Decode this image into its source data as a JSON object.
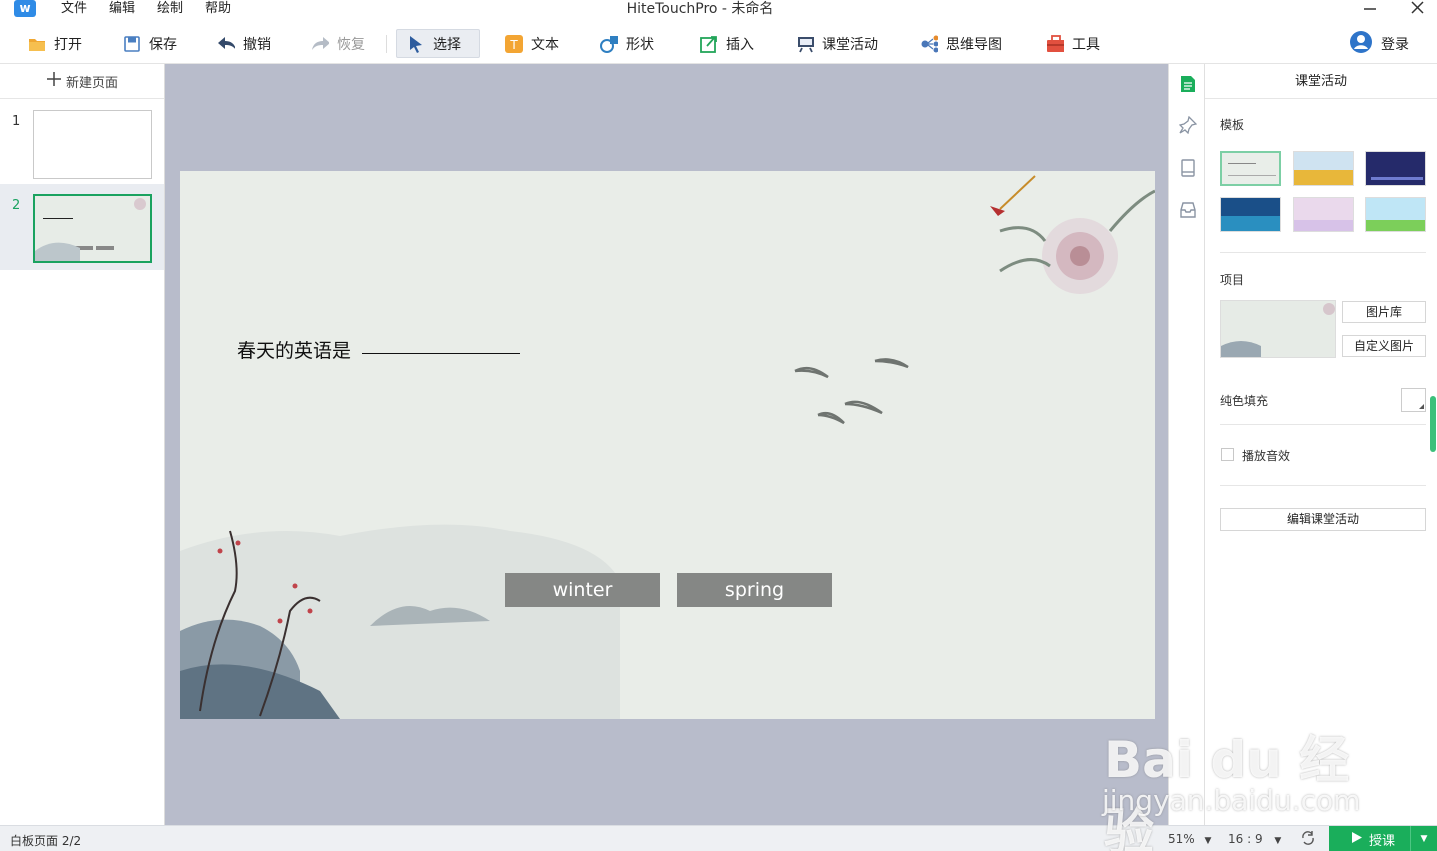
{
  "window": {
    "title": "HiteTouchPro - 未命名",
    "menu": [
      "文件",
      "编辑",
      "绘制",
      "帮助"
    ]
  },
  "toolbar": {
    "open": "打开",
    "save": "保存",
    "undo": "撤销",
    "redo": "恢复",
    "select": "选择",
    "text": "文本",
    "shape": "形状",
    "insert": "插入",
    "class_activity": "课堂活动",
    "mindmap": "思维导图",
    "tools": "工具",
    "login": "登录"
  },
  "pages": {
    "new_page": "新建页面",
    "items": [
      {
        "number": "1",
        "selected": false
      },
      {
        "number": "2",
        "selected": true
      }
    ]
  },
  "slide": {
    "question": "春天的英语是",
    "answers": [
      "winter",
      "spring"
    ]
  },
  "properties": {
    "title": "课堂活动",
    "template_label": "模板",
    "item_label": "项目",
    "image_library": "图片库",
    "custom_image": "自定义图片",
    "solid_fill": "纯色填充",
    "play_sound": "播放音效",
    "edit_activity": "编辑课堂活动"
  },
  "status": {
    "page_info": "白板页面 2/2",
    "zoom": "51%",
    "ratio": "16 : 9",
    "teach": "授课"
  },
  "watermark": {
    "brand": "Bai du 经验",
    "url": "jingyan.baidu.com"
  },
  "colors": {
    "accent_green": "#1aae5b",
    "canvas_bg": "#b8bccb",
    "answer_bg": "#858785"
  }
}
